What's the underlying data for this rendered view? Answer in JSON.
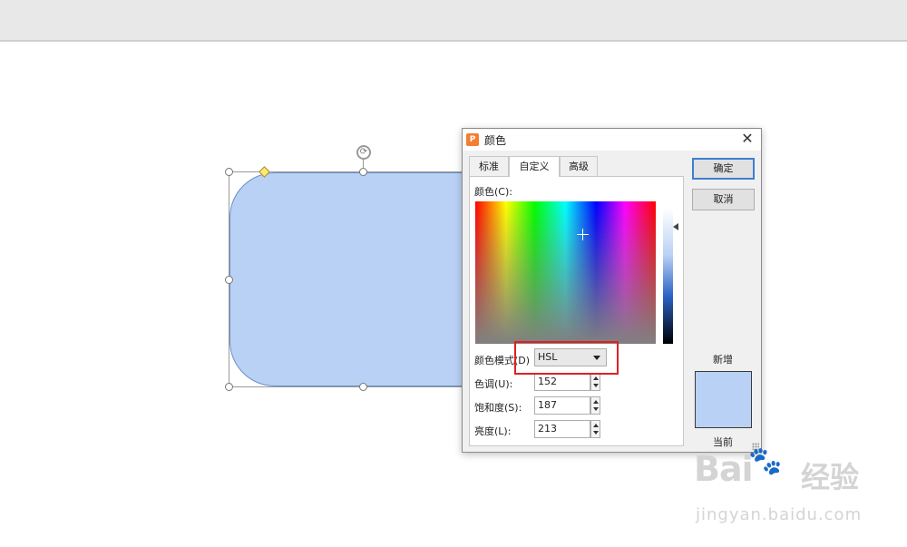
{
  "dialog": {
    "title": "颜色",
    "app_icon_glyph": "P",
    "close_glyph": "✕",
    "tabs": [
      {
        "label": "标准"
      },
      {
        "label": "自定义",
        "active": true
      },
      {
        "label": "高级"
      }
    ],
    "color_label": "颜色(C):",
    "mode_label": "颜色模式(D)",
    "mode_value": "HSL",
    "hue_label": "色调(U):",
    "hue_value": "152",
    "saturation_label": "饱和度(S):",
    "saturation_value": "187",
    "lightness_label": "亮度(L):",
    "lightness_value": "213",
    "ok_label": "确定",
    "cancel_label": "取消",
    "new_label": "新增",
    "current_label": "当前",
    "current_color": "#b9d1f4"
  },
  "canvas": {
    "shape_fill": "#b9d1f4",
    "shape_outline": "#6a8fc7",
    "rotate_glyph": "⟳"
  },
  "highlight_color": "#e02020",
  "watermark": {
    "logo_text": "Bai",
    "paw_glyph": "🐾",
    "cn_text": "经验",
    "url": "jingyan.baidu.com"
  }
}
